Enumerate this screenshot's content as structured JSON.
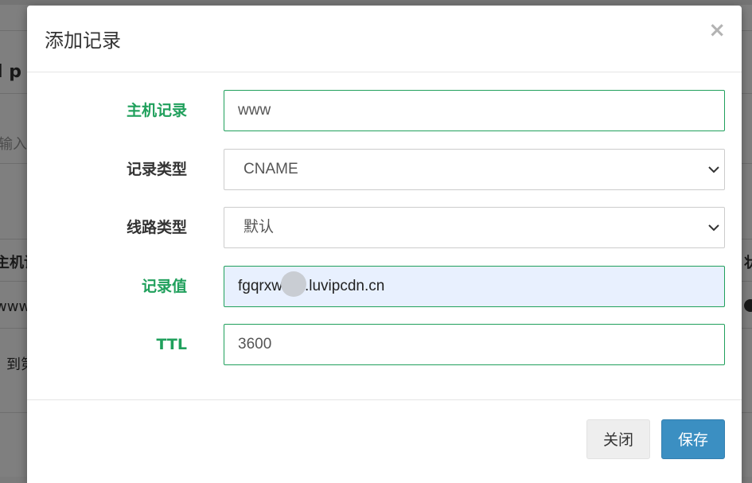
{
  "modal": {
    "title": "添加记录",
    "close_icon": "×"
  },
  "form": {
    "host_record": {
      "label": "主机记录",
      "value": "www"
    },
    "record_type": {
      "label": "记录类型",
      "value": "CNAME"
    },
    "line_type": {
      "label": "线路类型",
      "value": "默认"
    },
    "record_value": {
      "label": "记录值",
      "value_prefix": "fgqrxw",
      "value_suffix": ".luvipcdn.cn"
    },
    "ttl": {
      "label": "TTL",
      "value": "3600"
    }
  },
  "footer": {
    "close_label": "关闭",
    "save_label": "保存"
  },
  "background": {
    "partial_heading": "l p",
    "partial_input": "输入关",
    "partial_column": "主机记",
    "partial_cell": "www",
    "partial_link": "到第",
    "partial_right_col": "状"
  },
  "colors": {
    "label_required": "#20a05c",
    "primary_button": "#3b8fc2",
    "autofill_background": "#e8f0fe"
  }
}
